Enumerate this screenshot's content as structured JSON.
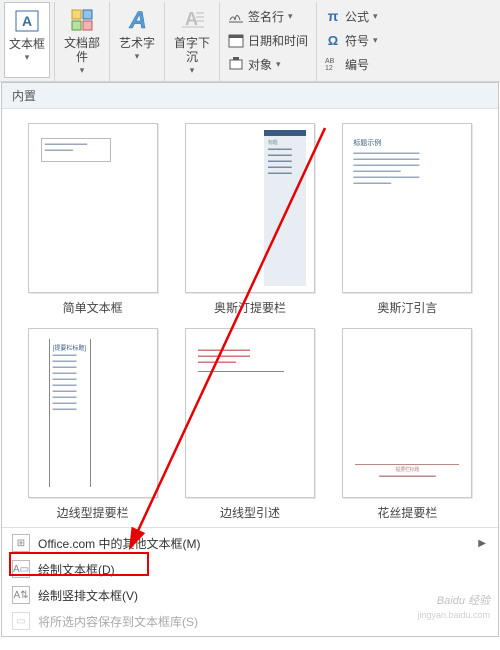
{
  "ribbon": {
    "textbox": "文本框",
    "quick_parts": "文档部件",
    "word_art": "艺术字",
    "drop_cap": "首字下沉",
    "sig_line": "签名行",
    "date_time": "日期和时间",
    "object": "对象",
    "equation": "公式",
    "symbol": "符号",
    "numbering": "编号"
  },
  "dropdown": {
    "section": "内置",
    "thumbs": [
      "简单文本框",
      "奥斯汀提要栏",
      "奥斯汀引言",
      "边线型提要栏",
      "边线型引述",
      "花丝提要栏"
    ],
    "menu": {
      "office_more": "Office.com 中的其他文本框(M)",
      "draw_text": "绘制文本框(D)",
      "draw_vert": "绘制竖排文本框(V)",
      "save_sel": "将所选内容保存到文本框库(S)"
    }
  },
  "watermark": {
    "main": "Baidu 经验",
    "sub": "jingyan.baidu.com"
  }
}
